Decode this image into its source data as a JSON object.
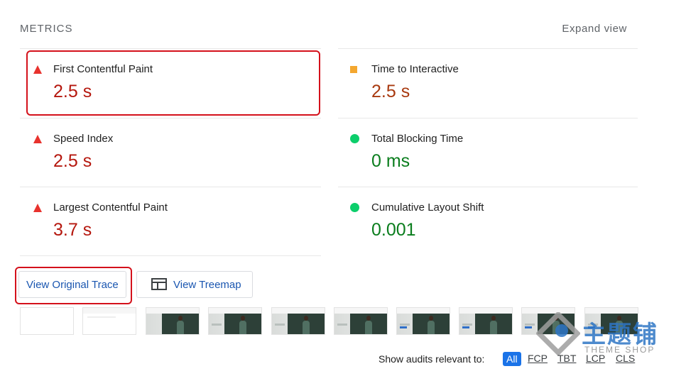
{
  "header": {
    "title": "METRICS",
    "expand_label": "Expand view"
  },
  "metrics": [
    {
      "label": "First Contentful Paint",
      "value": "2.5 s",
      "status": "fail"
    },
    {
      "label": "Time to Interactive",
      "value": "2.5 s",
      "status": "average"
    },
    {
      "label": "Speed Index",
      "value": "2.5 s",
      "status": "fail"
    },
    {
      "label": "Total Blocking Time",
      "value": "0 ms",
      "status": "pass"
    },
    {
      "label": "Largest Contentful Paint",
      "value": "3.7 s",
      "status": "fail"
    },
    {
      "label": "Cumulative Layout Shift",
      "value": "0.001",
      "status": "pass"
    }
  ],
  "buttons": {
    "view_original_trace": "View Original Trace",
    "view_treemap": "View Treemap"
  },
  "audit_filter": {
    "label": "Show audits relevant to:",
    "options": [
      "All",
      "FCP",
      "TBT",
      "LCP",
      "CLS"
    ],
    "selected": "All"
  },
  "watermark": {
    "text": "主题铺",
    "sub": "THEME SHOP"
  },
  "colors": {
    "fail": "#e8322d",
    "average": "#f4a72f",
    "pass": "#0cce6b",
    "highlight": "#d4111b",
    "link": "#1a56b0"
  }
}
